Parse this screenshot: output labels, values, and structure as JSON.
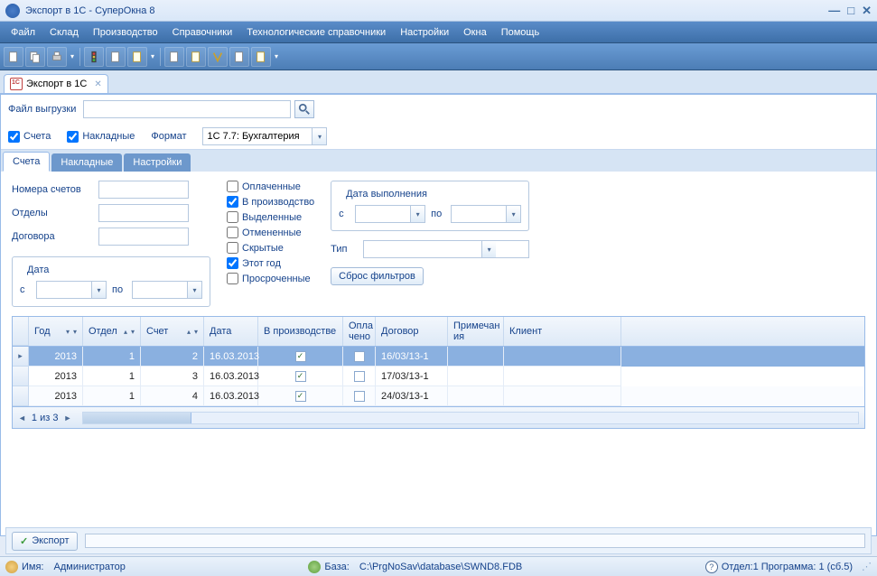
{
  "window": {
    "title": "Экспорт в 1С - СуперОкна 8"
  },
  "menu": [
    "Файл",
    "Склад",
    "Производство",
    "Справочники",
    "Технологические справочники",
    "Настройки",
    "Окна",
    "Помощь"
  ],
  "docTab": {
    "label": "Экспорт в 1С"
  },
  "fileRow": {
    "label": "Файл выгрузки",
    "value": ""
  },
  "options": {
    "accounts": {
      "label": "Счета",
      "checked": true
    },
    "invoices": {
      "label": "Накладные",
      "checked": true
    },
    "format_label": "Формат",
    "format_value": "1С 7.7: Бухгалтерия"
  },
  "subTabs": [
    "Счета",
    "Накладные",
    "Настройки"
  ],
  "filters": {
    "acctNums": "Номера счетов",
    "depts": "Отделы",
    "contracts": "Договора",
    "dateLegend": "Дата",
    "from": "с",
    "to": "по",
    "checks": {
      "paid": "Оплаченные",
      "inprod": "В производство",
      "selected": "Выделенные",
      "cancelled": "Отмененные",
      "hidden": "Скрытые",
      "thisyear": "Этот год",
      "overdue": "Просроченные"
    },
    "execLegend": "Дата выполнения",
    "typeLabel": "Тип",
    "resetBtn": "Сброс фильтров"
  },
  "grid": {
    "columns": {
      "year": "Год",
      "dept": "Отдел",
      "acct": "Счет",
      "date": "Дата",
      "inprod": "В производстве",
      "paid": "Опла чено",
      "contract": "Договор",
      "note": "Примечан ия",
      "client": "Клиент"
    },
    "rows": [
      {
        "year": "2013",
        "dept": "1",
        "acct": "2",
        "date": "16.03.2013",
        "inprod": true,
        "paid": false,
        "contract": "16/03/13-1",
        "selected": true
      },
      {
        "year": "2013",
        "dept": "1",
        "acct": "3",
        "date": "16.03.2013",
        "inprod": true,
        "paid": false,
        "contract": "17/03/13-1"
      },
      {
        "year": "2013",
        "dept": "1",
        "acct": "4",
        "date": "16.03.2013",
        "inprod": true,
        "paid": false,
        "contract": "24/03/13-1"
      }
    ],
    "nav": "1 из 3"
  },
  "actions": {
    "export": "Экспорт"
  },
  "status": {
    "user_label": "Имя:",
    "user": "Администратор",
    "db_label": "База:",
    "db": "C:\\PrgNoSav\\database\\SWND8.FDB",
    "right": "Отдел:1 Программа: 1 (сб.5)"
  }
}
